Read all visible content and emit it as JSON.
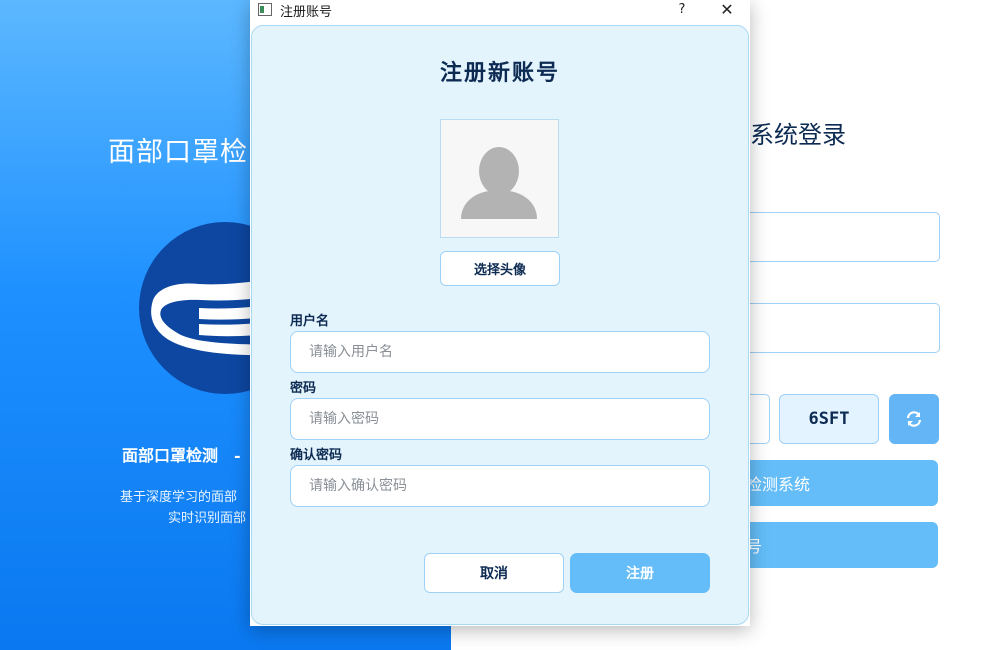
{
  "background": {
    "left": {
      "title": "面部口罩检",
      "subtitle": "面部口罩检测",
      "subtitle_dash": "-",
      "desc_line1": "基于深度学习的面部",
      "desc_line2": "实时识别面部",
      "mask_icon": "face-mask-icon"
    },
    "right": {
      "title": "系统登录",
      "captcha": "6SFT",
      "refresh_icon": "refresh-icon",
      "login_button": "检测系统",
      "register_button": "号"
    }
  },
  "dialog": {
    "window_title": "注册账号",
    "help": "?",
    "close": "✕",
    "heading": "注册新账号",
    "avatar_icon": "user-silhouette-icon",
    "select_avatar": "选择头像",
    "fields": {
      "username_label": "用户名",
      "username_placeholder": "请输入用户名",
      "password_label": "密码",
      "password_placeholder": "请输入密码",
      "confirm_label": "确认密码",
      "confirm_placeholder": "请输入确认密码"
    },
    "cancel": "取消",
    "register": "注册"
  },
  "colors": {
    "accent": "#64bdf8",
    "dark_text": "#0d2b52",
    "panel_bg": "#e3f4fd",
    "border": "#9fd0f5",
    "left_gradient_top": "#5cb8ff",
    "left_gradient_bottom": "#0a78f0",
    "mask_circle": "#0d47a1"
  }
}
